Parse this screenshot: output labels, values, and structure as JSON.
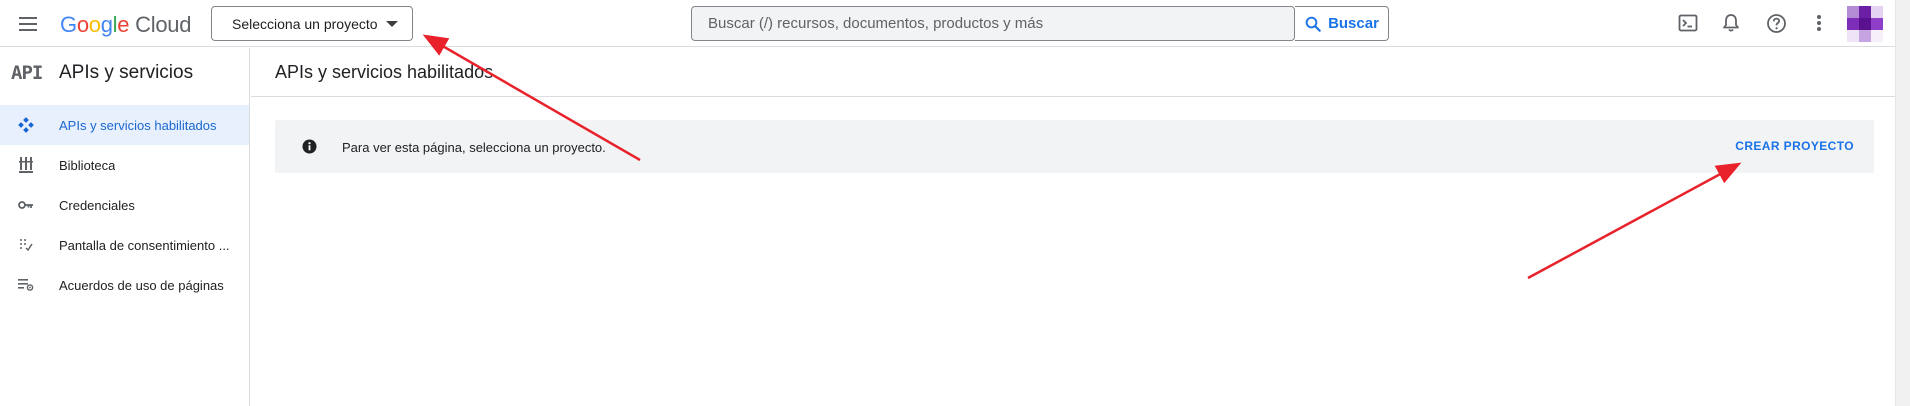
{
  "header": {
    "logo_google_letters": [
      "G",
      "o",
      "o",
      "g",
      "l",
      "e"
    ],
    "logo_cloud": "Cloud",
    "project_selector": "Selecciona un proyecto",
    "search_placeholder": "Buscar (/) recursos, documentos, productos y más",
    "search_button": "Buscar",
    "icons": [
      "terminal-icon",
      "bell-icon",
      "help-icon",
      "more-vert-icon"
    ]
  },
  "sidebar": {
    "mark": "API",
    "title": "APIs y servicios",
    "items": [
      {
        "label": "APIs y servicios habilitados",
        "icon": "api-diamond-icon",
        "active": true
      },
      {
        "label": "Biblioteca",
        "icon": "library-icon",
        "active": false
      },
      {
        "label": "Credenciales",
        "icon": "key-icon",
        "active": false
      },
      {
        "label": "Pantalla de consentimiento ...",
        "icon": "consent-icon",
        "active": false
      },
      {
        "label": "Acuerdos de uso de páginas",
        "icon": "page-usage-icon",
        "active": false
      }
    ]
  },
  "main": {
    "title": "APIs y servicios habilitados",
    "banner_text": "Para ver esta página, selecciona un proyecto.",
    "create_project": "CREAR PROYECTO"
  },
  "colors": {
    "accent": "#1a73e8",
    "active_bg": "#e8f0fe",
    "banner_bg": "#f1f3f4",
    "annotation_arrow": "#e8212a"
  }
}
